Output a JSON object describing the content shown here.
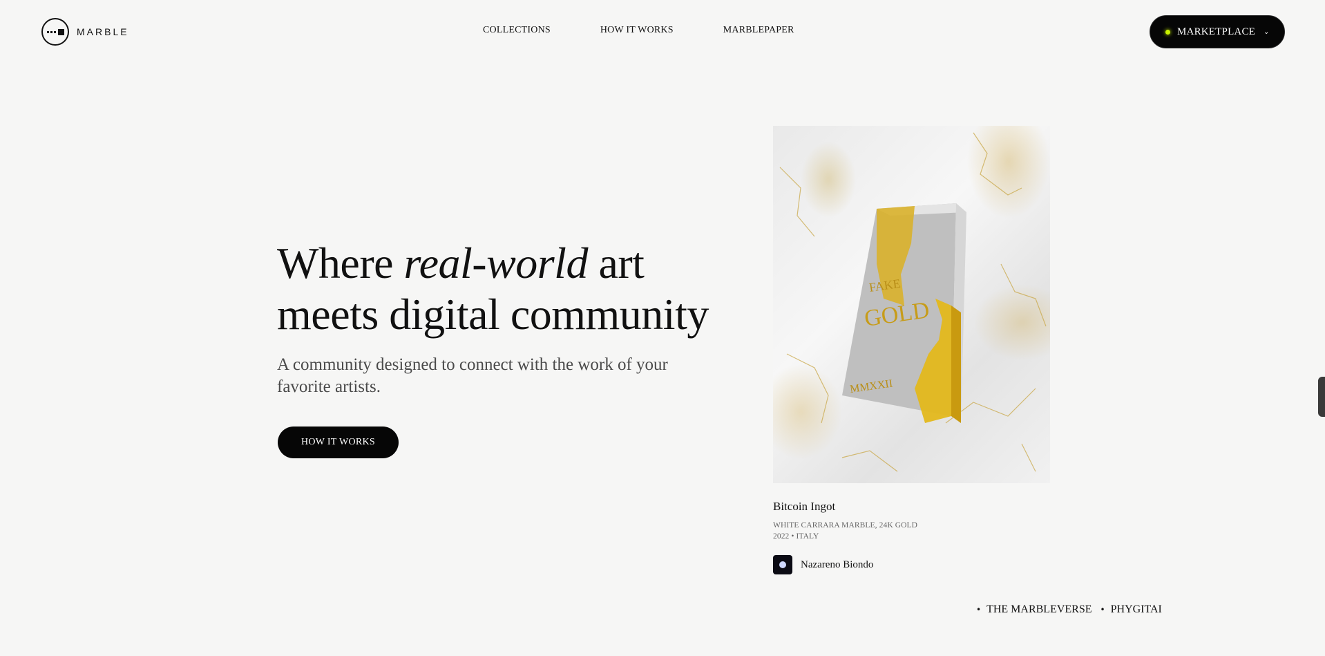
{
  "header": {
    "logo_text": "MARBLE",
    "nav": [
      "COLLECTIONS",
      "HOW IT WORKS",
      "MARBLEPAPER"
    ],
    "marketplace_label": "MARKETPLACE",
    "accent_color": "#c9f100"
  },
  "hero": {
    "headline_part1": "Where ",
    "headline_italic": "real-world",
    "headline_part2": " art",
    "headline_line2": "meets digital community",
    "subheadline": "A community designed to connect with the work of your favorite artists.",
    "cta_label": "HOW IT WORKS"
  },
  "artwork": {
    "title": "Bitcoin Ingot",
    "material": "WHITE CARRARA MARBLE, 24K GOLD",
    "year_origin": "2022 • ITALY",
    "artist": "Nazareno Biondo",
    "ingot_text": [
      "FAKE",
      "GOLD",
      "MMXXII"
    ]
  },
  "footer_tags": [
    "THE MARBLEVERSE",
    "PHYGITAI"
  ]
}
